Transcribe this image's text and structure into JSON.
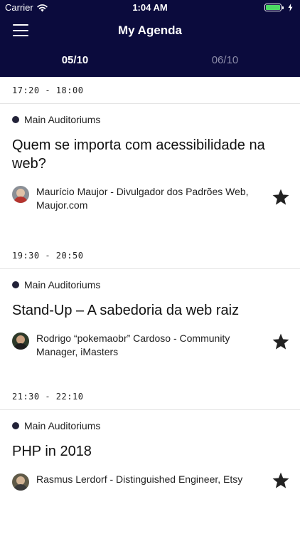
{
  "status_bar": {
    "carrier": "Carrier",
    "time": "1:04 AM"
  },
  "nav": {
    "title": "My Agenda",
    "menu_icon": "hamburger-menu-icon"
  },
  "tabs": [
    {
      "label": "05/10",
      "active": true
    },
    {
      "label": "06/10",
      "active": false
    }
  ],
  "sessions": [
    {
      "time": "17:20 - 18:00",
      "room": "Main Auditoriums",
      "title": "Quem se importa com acessibilidade na web?",
      "speaker": "Maurício Maujor - Divulgador dos Padrões Web, Maujor.com",
      "favorite_icon": "star-icon"
    },
    {
      "time": "19:30 - 20:50",
      "room": "Main Auditoriums",
      "title": "Stand-Up – A sabedoria da web raiz",
      "speaker": "Rodrigo “pokemaobr” Cardoso - Community Manager, iMasters",
      "favorite_icon": "star-icon"
    },
    {
      "time": "21:30 - 22:10",
      "room": "Main Auditoriums",
      "title": "PHP in 2018",
      "speaker": "Rasmus Lerdorf - Distinguished Engineer, Etsy",
      "favorite_icon": "star-icon"
    }
  ],
  "colors": {
    "header_bg": "#0b0b3d",
    "battery": "#4cd964",
    "star": "#222222"
  }
}
